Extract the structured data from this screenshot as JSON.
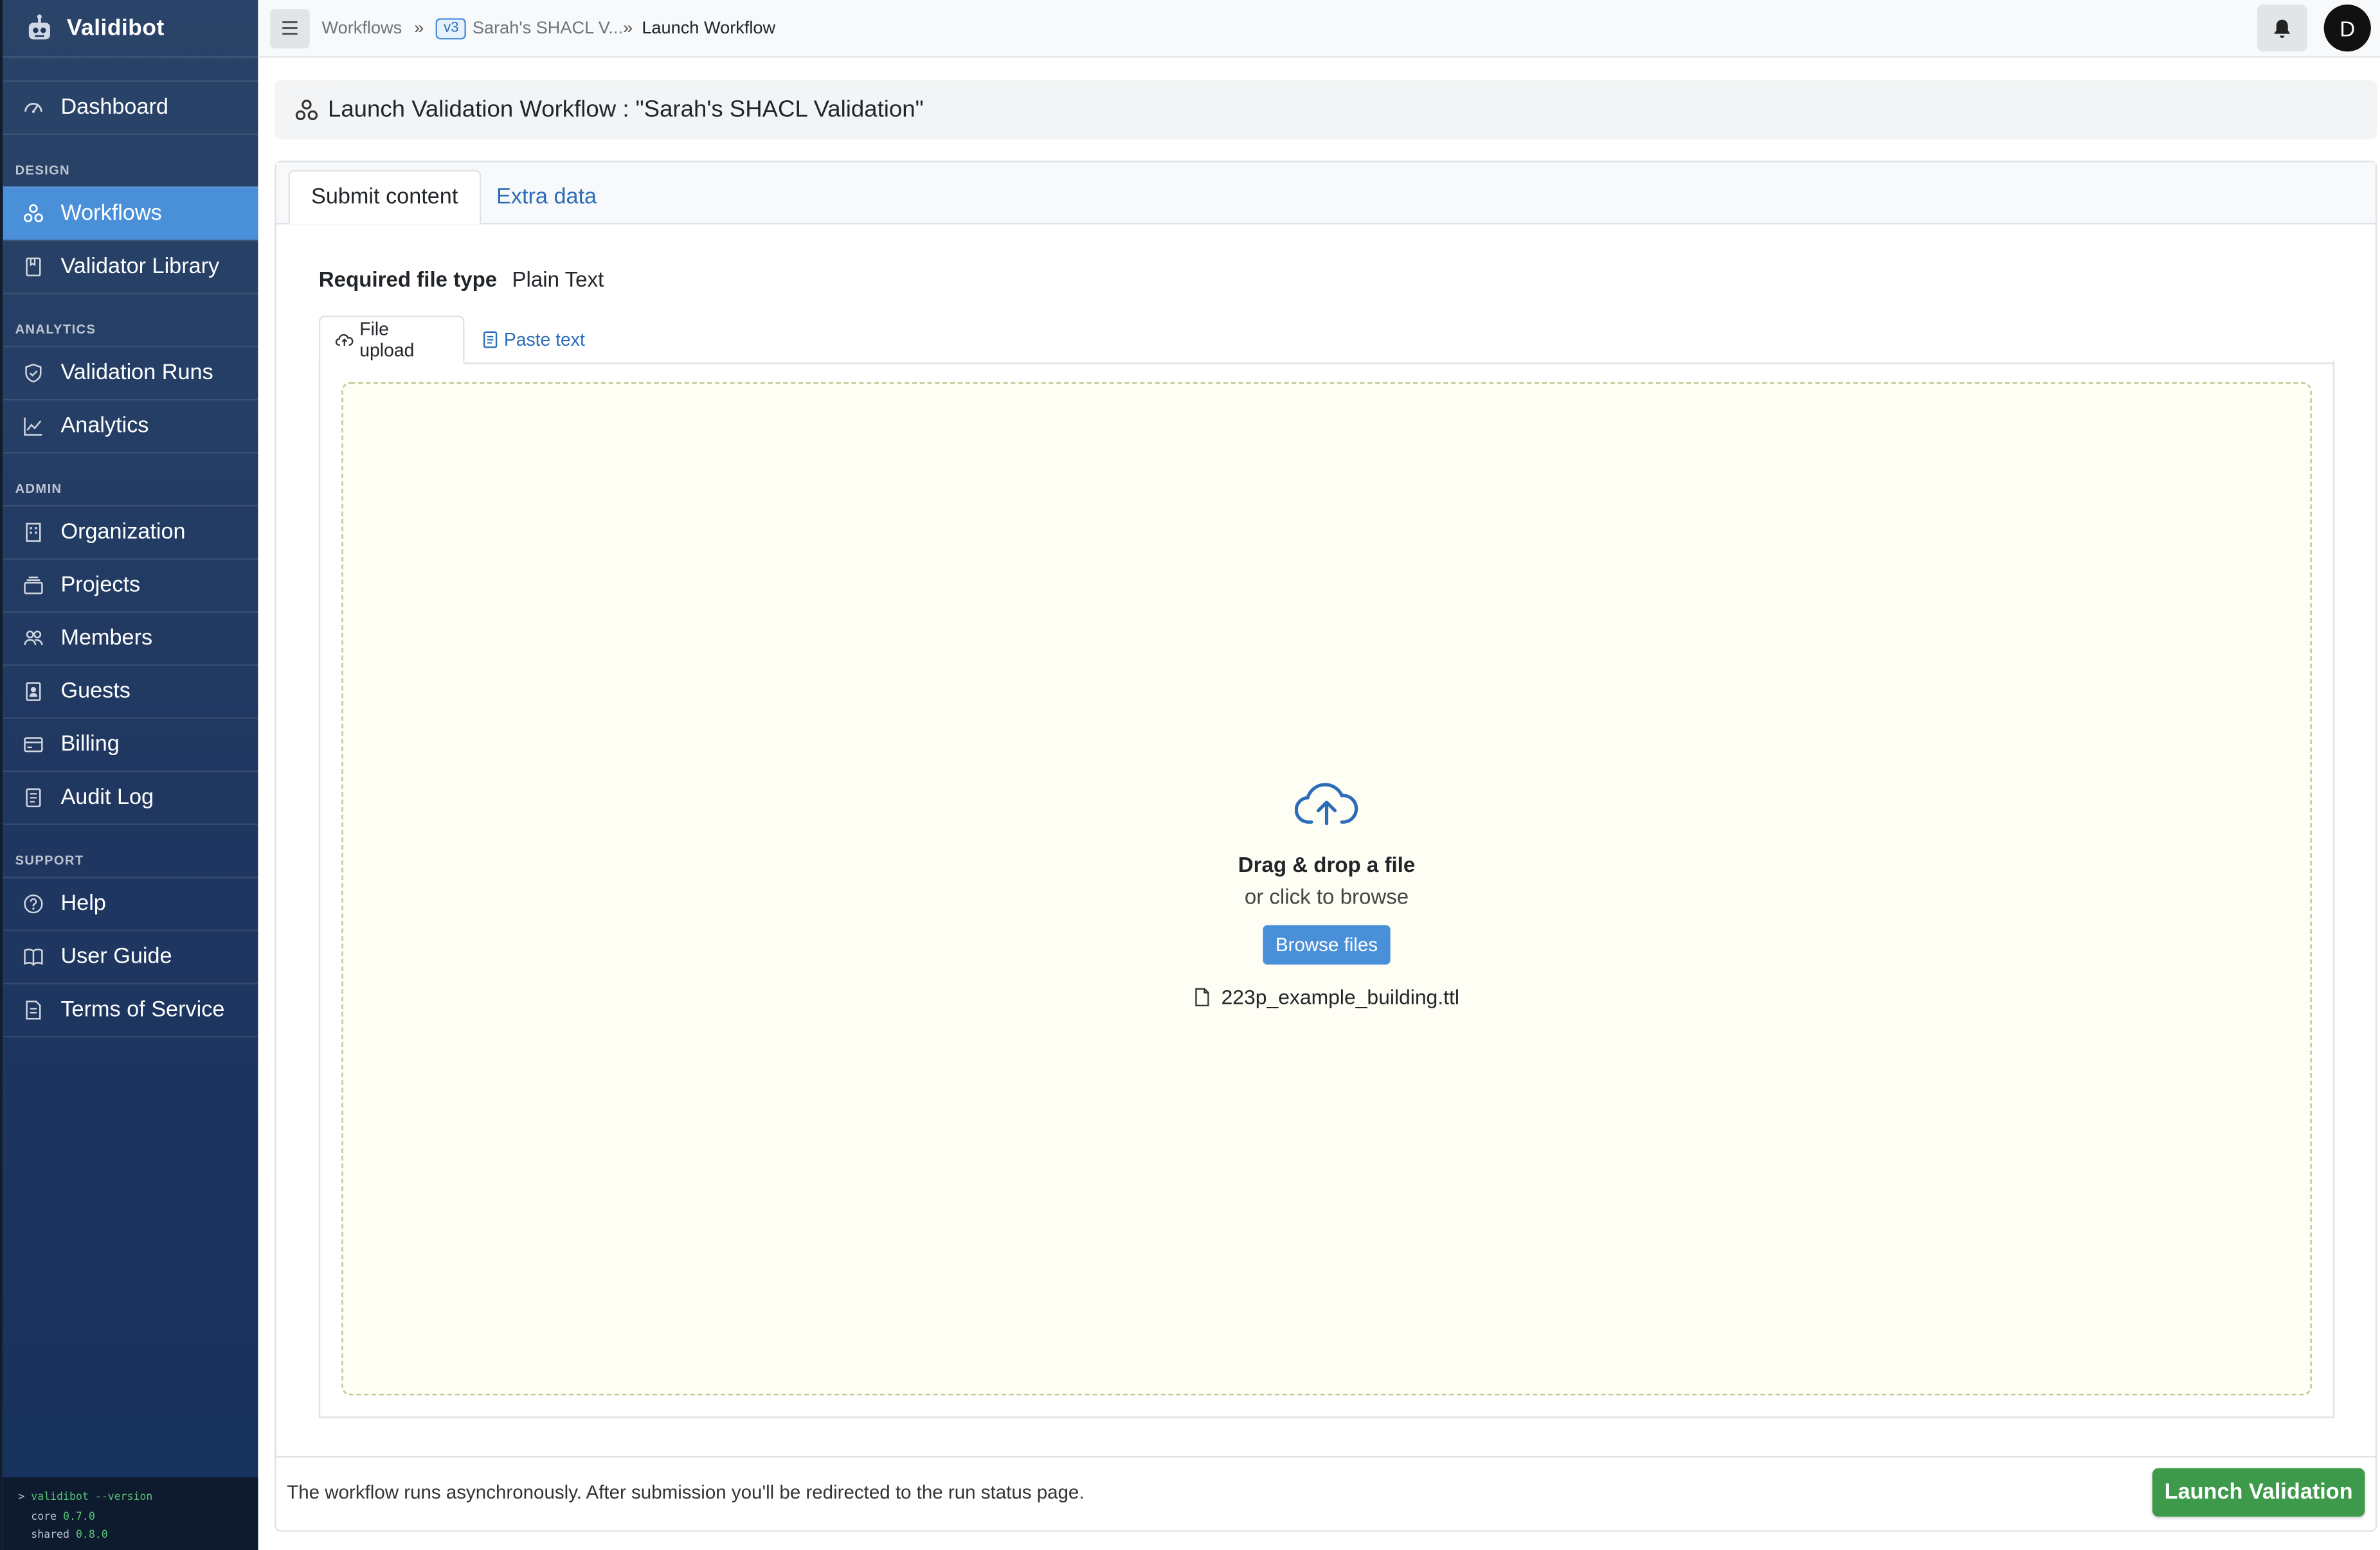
{
  "app": {
    "name": "Validibot"
  },
  "sidebar": {
    "top": [
      {
        "label": "Dashboard",
        "icon": "gauge-icon"
      }
    ],
    "sections": [
      {
        "label": "DESIGN",
        "items": [
          {
            "label": "Workflows",
            "icon": "workflow-icon",
            "active": true
          },
          {
            "label": "Validator Library",
            "icon": "bookmark-book-icon"
          }
        ]
      },
      {
        "label": "ANALYTICS",
        "items": [
          {
            "label": "Validation Runs",
            "icon": "shield-check-icon"
          },
          {
            "label": "Analytics",
            "icon": "line-chart-icon"
          }
        ]
      },
      {
        "label": "ADMIN",
        "items": [
          {
            "label": "Organization",
            "icon": "building-icon"
          },
          {
            "label": "Projects",
            "icon": "stack-icon"
          },
          {
            "label": "Members",
            "icon": "people-icon"
          },
          {
            "label": "Guests",
            "icon": "id-badge-icon"
          },
          {
            "label": "Billing",
            "icon": "credit-card-icon"
          },
          {
            "label": "Audit Log",
            "icon": "journal-icon"
          }
        ]
      },
      {
        "label": "SUPPORT",
        "items": [
          {
            "label": "Help",
            "icon": "question-circle-icon"
          },
          {
            "label": "User Guide",
            "icon": "book-icon"
          },
          {
            "label": "Terms of Service",
            "icon": "document-icon"
          }
        ]
      }
    ],
    "terminal": {
      "prompt": "> ",
      "command": "validibot --version",
      "core_label": "core",
      "core_version": "0.7.0",
      "shared_label": "shared",
      "shared_version": "0.8.0"
    }
  },
  "topbar": {
    "breadcrumb": {
      "root": "Workflows",
      "sep": "»",
      "version_badge": "v3",
      "workflow": "Sarah's SHACL V...",
      "current": "Launch Workflow"
    },
    "avatar_initial": "D"
  },
  "main": {
    "header_title": "Launch Validation Workflow : \"Sarah's SHACL Validation\"",
    "tabs": {
      "submit": "Submit content",
      "extra": "Extra data"
    },
    "required_label": "Required file type",
    "required_value": "Plain Text",
    "subtabs": {
      "upload": "File upload",
      "paste": "Paste text"
    },
    "dropzone": {
      "title": "Drag & drop a file",
      "subtitle": "or click to browse",
      "browse_label": "Browse files",
      "file_name": "223p_example_building.ttl"
    },
    "footer_note": "The workflow runs asynchronously. After submission you'll be redirected to the run status page.",
    "launch_label": "Launch Validation"
  },
  "colors": {
    "sidebar": "#1f3760",
    "active": "#4a90d9",
    "launch": "#3d9a4b",
    "link": "#2a6cb8"
  }
}
